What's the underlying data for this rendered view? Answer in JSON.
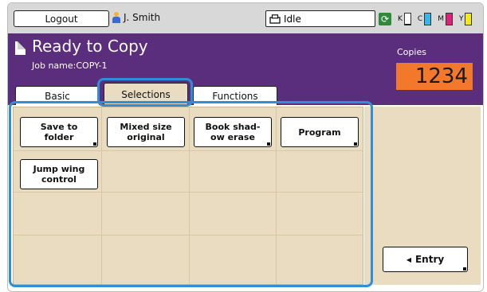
{
  "topbar": {
    "logout_label": "Logout",
    "user_name": "J. Smith",
    "status_text": "Idle",
    "ink_levels": [
      {
        "label": "K",
        "color": "#111111",
        "level": 0.05
      },
      {
        "label": "C",
        "color": "#35b7ec",
        "level": 0.95
      },
      {
        "label": "M",
        "color": "#e0207a",
        "level": 0.95
      },
      {
        "label": "Y",
        "color": "#f4e81a",
        "level": 0.95
      }
    ]
  },
  "header": {
    "title": "Ready to Copy",
    "job_name": "Job name:COPY-1",
    "copies_label": "Copies",
    "copies_value": "1234",
    "tabs": [
      {
        "label": "Basic",
        "active": false
      },
      {
        "label": "Selections",
        "active": true
      },
      {
        "label": "Functions",
        "active": false
      }
    ]
  },
  "panel": {
    "buttons": [
      {
        "label": "Save to\nfolder",
        "has_submenu": true
      },
      {
        "label": "Mixed size\noriginal",
        "has_submenu": false
      },
      {
        "label": "Book shad-\now erase",
        "has_submenu": true
      },
      {
        "label": "Program",
        "has_submenu": true
      },
      {
        "label": "Jump wing\ncontrol",
        "has_submenu": false
      }
    ]
  },
  "side": {
    "entry_label": "Entry"
  },
  "colors": {
    "header_bg": "#5b2d7d",
    "copies_bg": "#f2792b",
    "panel_bg": "#e9dcc0",
    "highlight": "#2f8fd6"
  }
}
